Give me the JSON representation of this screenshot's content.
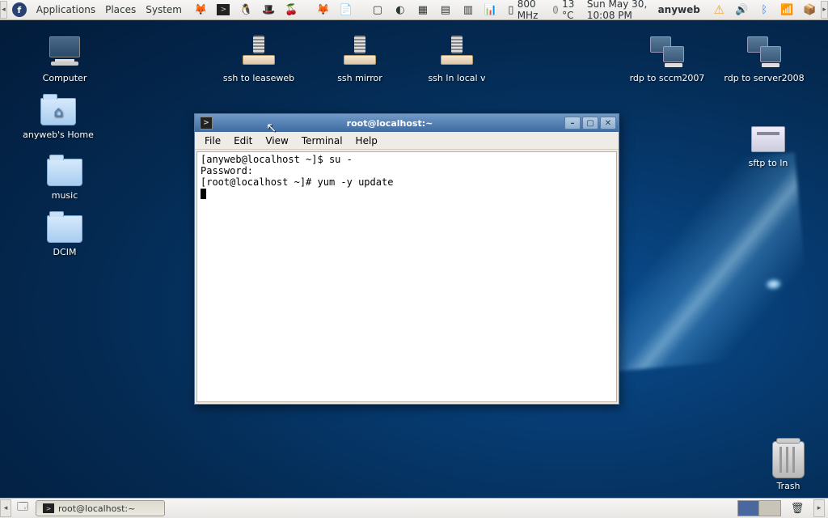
{
  "top_panel": {
    "menus": [
      "Applications",
      "Places",
      "System"
    ],
    "cpu_freq": "800 MHz",
    "temp": "13 °C",
    "clock": "Sun May 30, 10:08 PM",
    "user": "anyweb"
  },
  "desktop_icons": {
    "computer": "Computer",
    "home": "anyweb's Home",
    "music": "music",
    "dcim": "DCIM",
    "ssh_leaseweb": "ssh to leaseweb",
    "ssh_mirror": "ssh mirror",
    "ssh_ln_local": "ssh ln local v",
    "rdp_sccm": "rdp to sccm2007",
    "rdp_server": "rdp to server2008",
    "sftp_ln": "sftp to ln",
    "trash": "Trash"
  },
  "terminal": {
    "title": "root@localhost:~",
    "menus": [
      "File",
      "Edit",
      "View",
      "Terminal",
      "Help"
    ],
    "lines": [
      "[anyweb@localhost ~]$ su -",
      "Password:",
      "[root@localhost ~]# yum -y update"
    ]
  },
  "bottom_panel": {
    "task_label": "root@localhost:~"
  }
}
